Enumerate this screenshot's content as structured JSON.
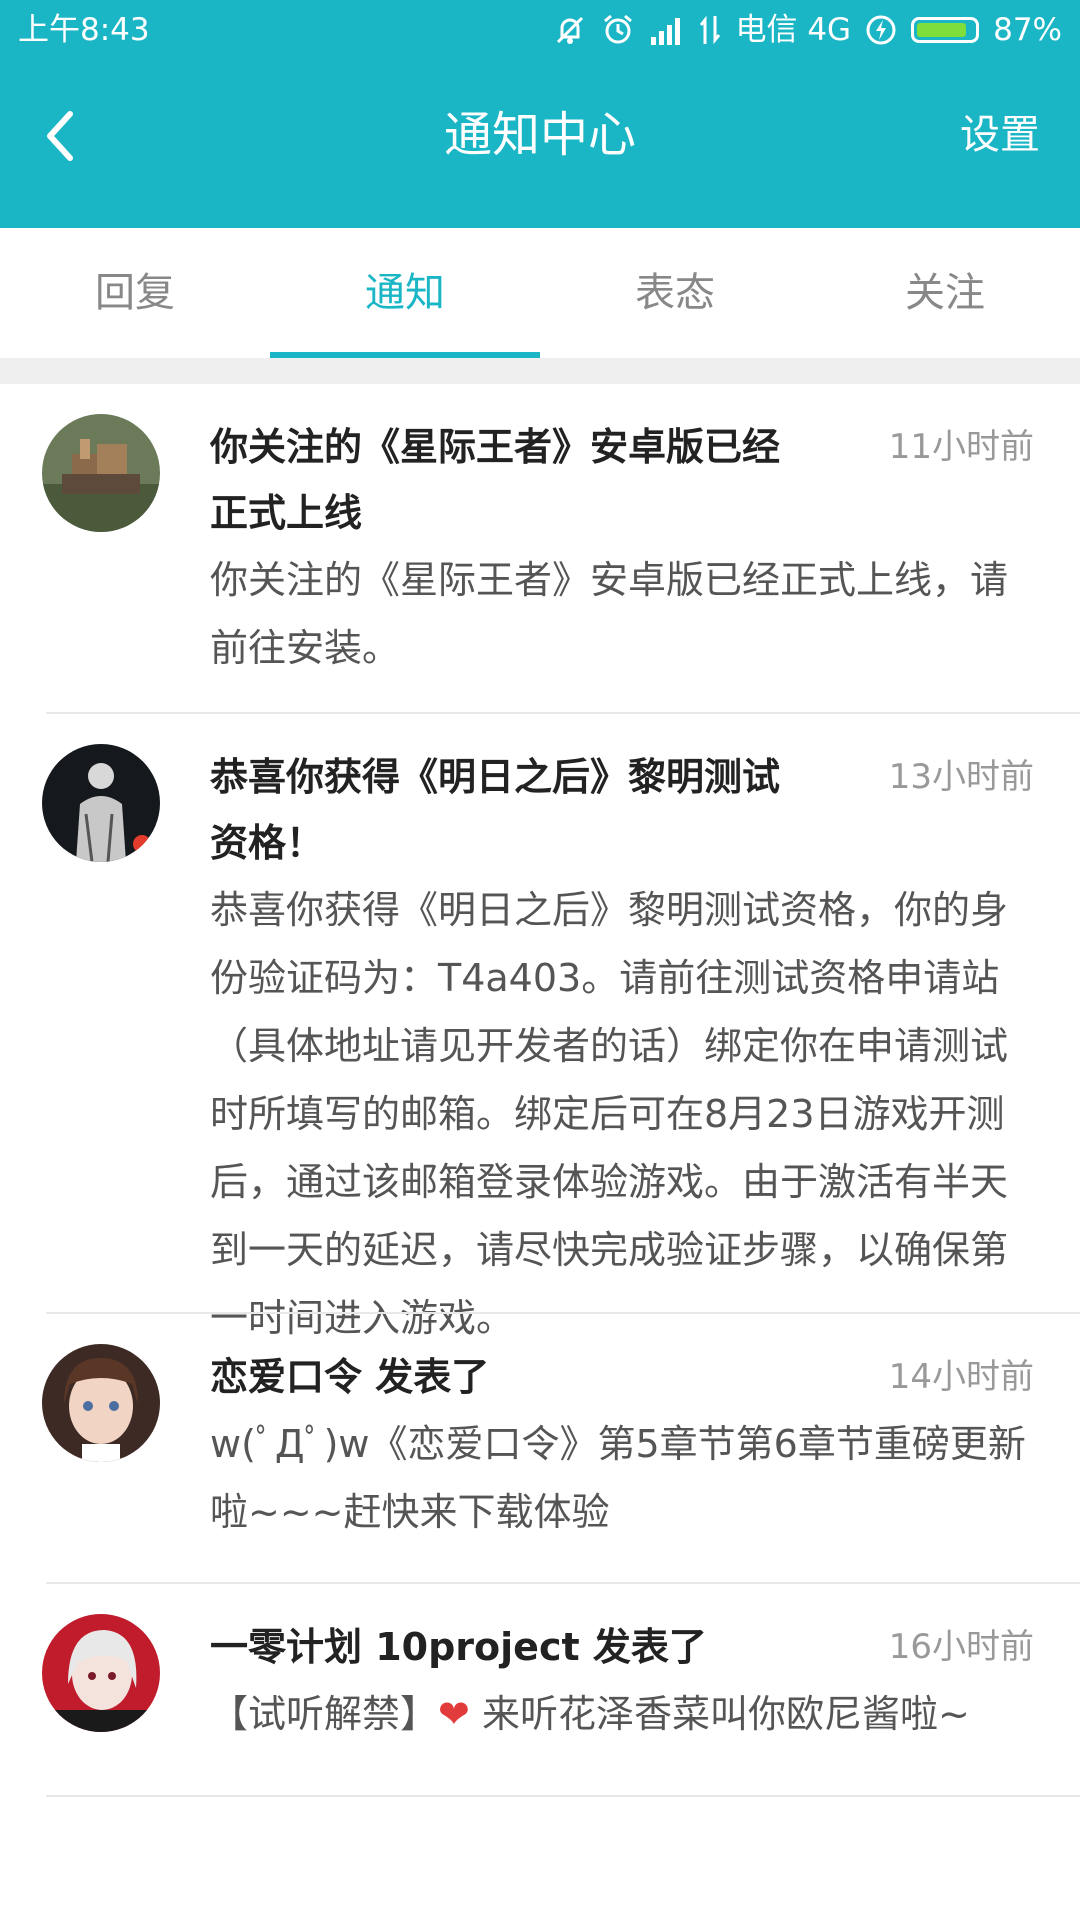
{
  "status_bar": {
    "time": "上午8:43",
    "carrier": "电信 4G",
    "battery_text": "87%",
    "battery_level": 0.87,
    "icons": [
      "mute-icon",
      "alarm-icon",
      "signal-icon",
      "data-arrows-icon",
      "charging-icon",
      "battery-icon"
    ]
  },
  "header": {
    "title": "通知中心",
    "settings_label": "设置",
    "back_icon": "chevron-left-icon",
    "background_color": "#1ab6c6"
  },
  "tabs": [
    {
      "label": "回复",
      "active": false
    },
    {
      "label": "通知",
      "active": true
    },
    {
      "label": "表态",
      "active": false
    },
    {
      "label": "关注",
      "active": false
    }
  ],
  "notifications": [
    {
      "title": "你关注的《星际王者》安卓版已经正式上线",
      "time": "11小时前",
      "body": "你关注的《星际王者》安卓版已经正式上线，请前往安装。"
    },
    {
      "title": "恭喜你获得《明日之后》黎明测试资格！",
      "time": "13小时前",
      "body": "恭喜你获得《明日之后》黎明测试资格，你的身份验证码为：T4a403。请前往测试资格申请站（具体地址请见开发者的话）绑定你在申请测试时所填写的邮箱。绑定后可在8月23日游戏开测后，通过该邮箱登录体验游戏。由于激活有半天到一天的延迟，请尽快完成验证步骤，以确保第一时间进入游戏。"
    },
    {
      "title": "恋爱口令 发表了",
      "time": "14小时前",
      "body": "w(ﾟДﾟ)w《恋爱口令》第5章节第6章节重磅更新啦~~~赶快来下载体验"
    },
    {
      "title": "一零计划 10project 发表了",
      "time": "16小时前",
      "body_prefix": "【试听解禁】",
      "body_suffix": " 来听花泽香菜叫你欧尼酱啦~",
      "heart": "❤"
    }
  ],
  "colors": {
    "accent": "#1ab6c6",
    "separator": "#efefef"
  }
}
